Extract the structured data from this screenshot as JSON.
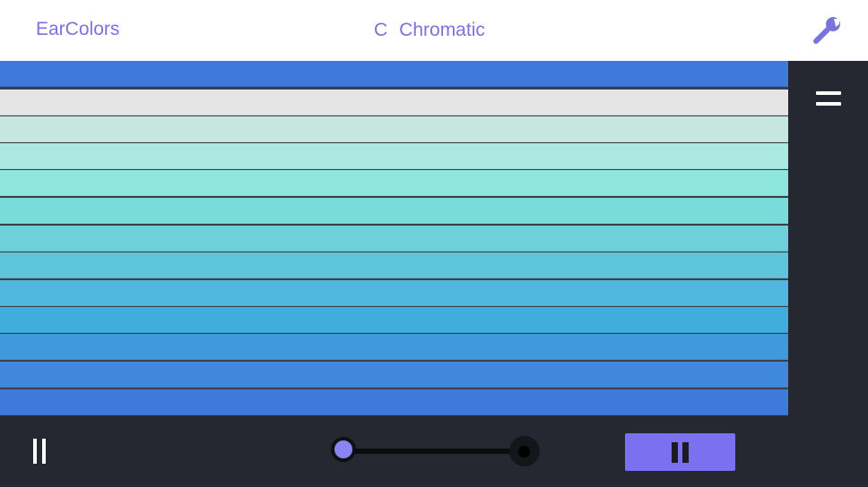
{
  "header": {
    "app_title": "EarColors",
    "key_root": "C",
    "scale_name": "Chromatic",
    "settings_icon": "wrench-icon"
  },
  "strips": [
    {
      "color": "#3f79d9"
    },
    {
      "color": "#e5e5e5"
    },
    {
      "color": "#c6e6e0"
    },
    {
      "color": "#abe8df"
    },
    {
      "color": "#8fe6dc"
    },
    {
      "color": "#7adcd9"
    },
    {
      "color": "#6dd0da"
    },
    {
      "color": "#5fc5dc"
    },
    {
      "color": "#50b8de"
    },
    {
      "color": "#3fadde"
    },
    {
      "color": "#3f99dc"
    },
    {
      "color": "#3f88dc"
    },
    {
      "color": "#3f79d9"
    }
  ],
  "side_panel": {
    "menu_icon": "equals-menu-icon"
  },
  "controls": {
    "pause_icon": "pause-icon",
    "slider_value": 0,
    "play_button_icon": "pause-icon"
  },
  "colors": {
    "accent": "#7a73dd",
    "button": "#7a70f0",
    "panel": "#252830"
  }
}
